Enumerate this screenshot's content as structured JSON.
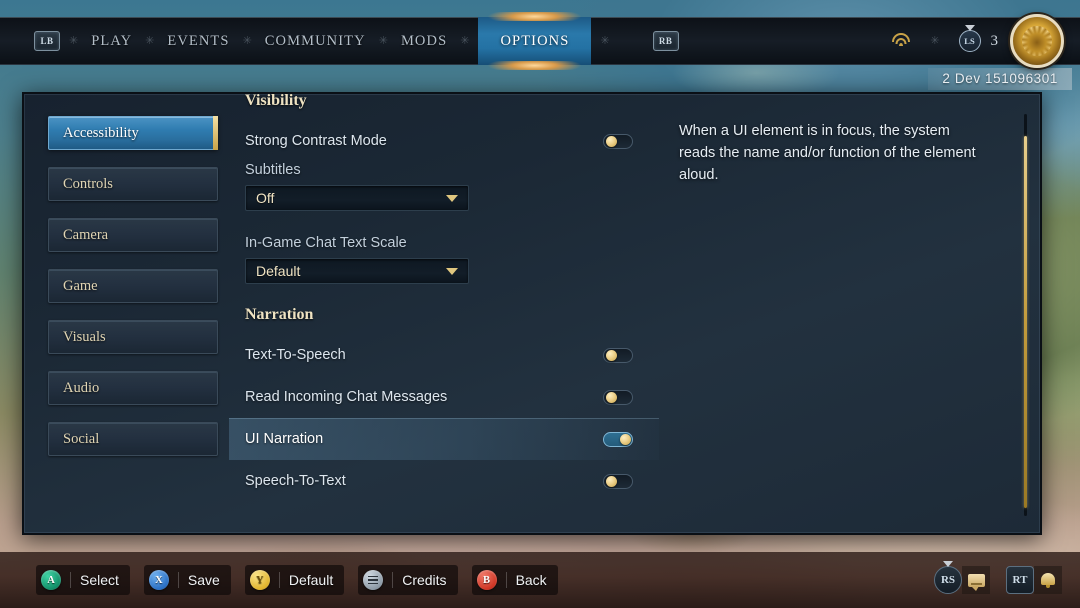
{
  "topnav": {
    "left_bumper": "LB",
    "right_bumper": "RB",
    "separator": "✳",
    "items": [
      {
        "label": "PLAY",
        "active": false
      },
      {
        "label": "EVENTS",
        "active": false
      },
      {
        "label": "COMMUNITY",
        "active": false
      },
      {
        "label": "MODS",
        "active": false
      },
      {
        "label": "OPTIONS",
        "active": true
      }
    ],
    "status": {
      "wifi_icon": "wifi-icon",
      "left_stick_badge": "LS",
      "notification_count": "3",
      "emblem_icon": "sun-emblem-icon"
    }
  },
  "version": "2 Dev 151096301",
  "sidebar": {
    "items": [
      {
        "label": "Accessibility",
        "active": true
      },
      {
        "label": "Controls",
        "active": false
      },
      {
        "label": "Camera",
        "active": false
      },
      {
        "label": "Game",
        "active": false
      },
      {
        "label": "Visuals",
        "active": false
      },
      {
        "label": "Audio",
        "active": false
      },
      {
        "label": "Social",
        "active": false
      }
    ]
  },
  "settings": {
    "groups": [
      {
        "header": "Visibility",
        "rows": [
          {
            "type": "toggle",
            "label": "Strong Contrast Mode",
            "value": "off"
          },
          {
            "type": "dropdown",
            "label": "Subtitles",
            "value": "Off"
          },
          {
            "type": "dropdown",
            "label": "In-Game Chat Text Scale",
            "value": "Default"
          }
        ]
      },
      {
        "header": "Narration",
        "rows": [
          {
            "type": "toggle",
            "label": "Text-To-Speech",
            "value": "off",
            "selected": false
          },
          {
            "type": "toggle",
            "label": "Read Incoming Chat Messages",
            "value": "off",
            "selected": false
          },
          {
            "type": "toggle",
            "label": "UI Narration",
            "value": "on",
            "selected": true
          },
          {
            "type": "toggle",
            "label": "Speech-To-Text",
            "value": "off",
            "selected": false
          }
        ]
      }
    ]
  },
  "description": {
    "text": "When a UI element is in focus, the system reads the name and/or function of the element aloud."
  },
  "bottombar": {
    "hints": [
      {
        "button": "A",
        "kind": "a",
        "label": "Select"
      },
      {
        "button": "X",
        "kind": "x",
        "label": "Save"
      },
      {
        "button": "Y",
        "kind": "y",
        "label": "Default"
      },
      {
        "button": "",
        "kind": "menu",
        "label": "Credits"
      },
      {
        "button": "B",
        "kind": "b",
        "label": "Back"
      }
    ],
    "right": [
      {
        "button": "RS",
        "icon": "chat-bubble-icon"
      },
      {
        "button": "RT",
        "icon": "bell-icon"
      }
    ]
  },
  "colors": {
    "accent_gold": "#c9a348",
    "accent_blue": "#2a79ab",
    "panel_bg": "#1b2835",
    "toggle_on": "#2e6f92"
  }
}
